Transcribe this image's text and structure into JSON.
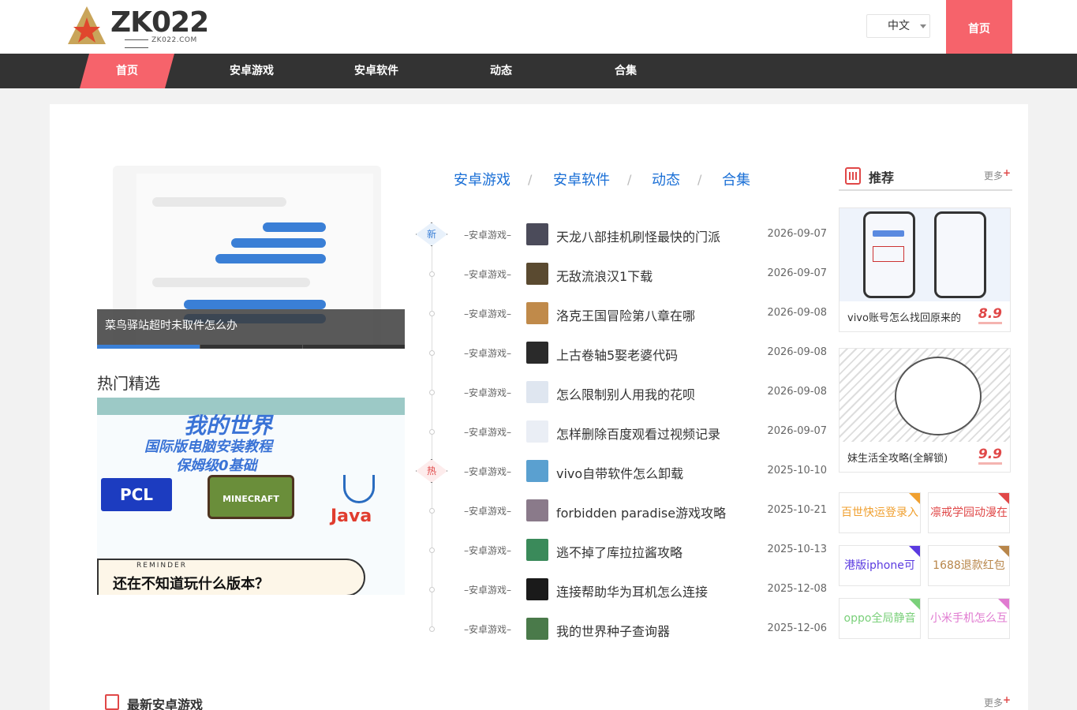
{
  "header": {
    "logo_text": "ZK022",
    "logo_sub": "ZK022.COM",
    "language": "中文",
    "home_tab": "首页"
  },
  "nav": [
    "首页",
    "安卓游戏",
    "安卓软件",
    "动态",
    "合集"
  ],
  "slider": {
    "caption": "菜鸟驿站超时未取件怎么办"
  },
  "hot": {
    "title": "热门精选",
    "line1": "我的世界",
    "line2": "国际版电脑安装教程",
    "line3": "保姆级0基础",
    "pcl": "PCL",
    "mc": "MINECRAFT",
    "java": "Java",
    "reminder_tag": "REMINDER",
    "reminder_text": "还在不知道玩什么版本？"
  },
  "categories": [
    "安卓游戏",
    "安卓软件",
    "动态",
    "合集"
  ],
  "list": [
    {
      "cat": "–安卓游戏–",
      "title": "天龙八部挂机刷怪最快的门派",
      "date": "2026-09-07",
      "flag": "新",
      "thumb": "#4b4b5a"
    },
    {
      "cat": "–安卓游戏–",
      "title": "无敌流浪汉1下载",
      "date": "2026-09-07",
      "flag": "",
      "thumb": "#5a4a30"
    },
    {
      "cat": "–安卓游戏–",
      "title": "洛克王国冒险第八章在哪",
      "date": "2026-09-08",
      "flag": "",
      "thumb": "#c08a4a"
    },
    {
      "cat": "–安卓游戏–",
      "title": "上古卷轴5娶老婆代码",
      "date": "2026-09-08",
      "flag": "",
      "thumb": "#2a2a2a"
    },
    {
      "cat": "–安卓游戏–",
      "title": "怎么限制别人用我的花呗",
      "date": "2026-09-08",
      "flag": "",
      "thumb": "#dfe6f0"
    },
    {
      "cat": "–安卓游戏–",
      "title": "怎样删除百度观看过视频记录",
      "date": "2026-09-07",
      "flag": "",
      "thumb": "#eaeef5"
    },
    {
      "cat": "–安卓游戏–",
      "title": "vivo自带软件怎么卸载",
      "date": "2025-10-10",
      "flag": "热",
      "thumb": "#5aa0d0"
    },
    {
      "cat": "–安卓游戏–",
      "title": "forbidden paradise游戏攻略",
      "date": "2025-10-21",
      "flag": "",
      "thumb": "#8a7a8a"
    },
    {
      "cat": "–安卓游戏–",
      "title": "逃不掉了库拉拉酱攻略",
      "date": "2025-10-13",
      "flag": "",
      "thumb": "#3a8a5a"
    },
    {
      "cat": "–安卓游戏–",
      "title": "连接帮助华为耳机怎么连接",
      "date": "2025-12-08",
      "flag": "",
      "thumb": "#1a1a1a"
    },
    {
      "cat": "–安卓游戏–",
      "title": "我的世界种子查询器",
      "date": "2025-12-06",
      "flag": "",
      "thumb": "#4a7a4a"
    }
  ],
  "recommend": {
    "title": "推荐",
    "more": "更多",
    "cards": [
      {
        "name": "vivo账号怎么找回原来的",
        "score": "8.9"
      },
      {
        "name": "妹生活全攻略(全解锁)",
        "score": "9.9"
      }
    ],
    "tags": [
      {
        "label": "百世快运登录入",
        "color": "#f0a030"
      },
      {
        "label": "凛戒学园动漫在",
        "color": "#e04848"
      },
      {
        "label": "港版iphone可",
        "color": "#5a3ae0"
      },
      {
        "label": "1688退款红包",
        "color": "#b8864a"
      },
      {
        "label": "oppo全局静音",
        "color": "#7ad07a"
      },
      {
        "label": "小米手机怎么互",
        "color": "#e07ad0"
      }
    ]
  },
  "latest": {
    "title": "最新安卓游戏",
    "more": "更多"
  }
}
